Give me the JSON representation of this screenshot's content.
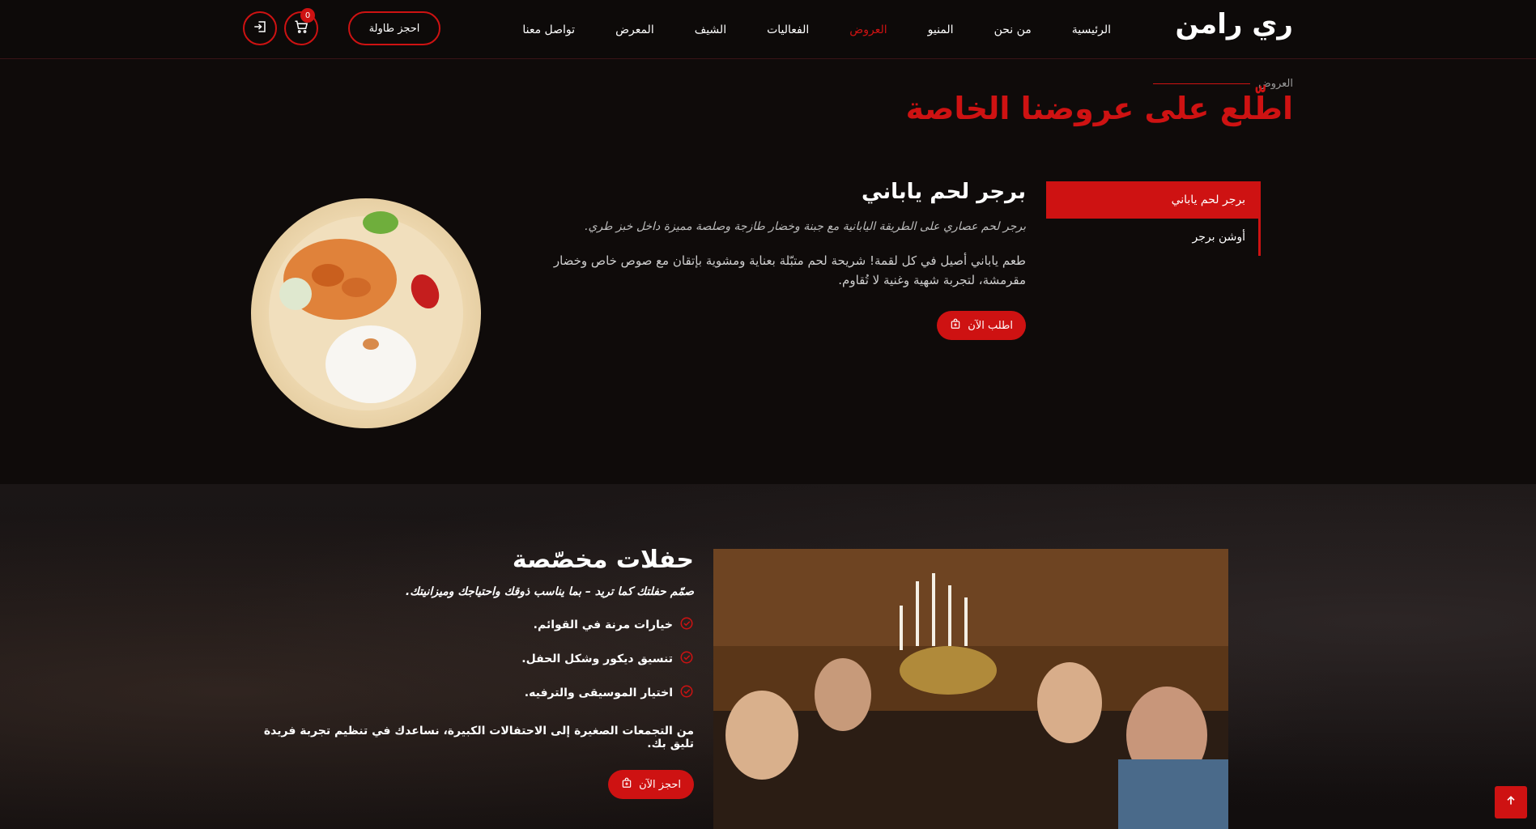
{
  "header": {
    "logo": "ري رامن",
    "nav": [
      {
        "label": "الرئيسية",
        "active": false
      },
      {
        "label": "من نحن",
        "active": false
      },
      {
        "label": "المنيو",
        "active": false
      },
      {
        "label": "العروض",
        "active": true
      },
      {
        "label": "الفعاليات",
        "active": false
      },
      {
        "label": "الشيف",
        "active": false
      },
      {
        "label": "المعرض",
        "active": false
      },
      {
        "label": "تواصل معنا",
        "active": false
      }
    ],
    "book_label": "احجز طاولة",
    "cart_count": "0",
    "cart_icon": "cart-icon",
    "login_icon": "login-icon"
  },
  "offers": {
    "eyebrow": "العروض",
    "title": "اطّلع على عروضنا الخاصة",
    "tabs": [
      {
        "label": "برجر لحم ياباني",
        "active": true
      },
      {
        "label": "أوشن برجر",
        "active": false
      }
    ],
    "active_offer": {
      "title": "برجر لحم ياباني",
      "subtitle": "برجر لحم عصاري على الطريقة اليابانية مع جبنة وخضار طازجة وصلصة مميزة داخل خبز طري.",
      "description": "طعم ياباني أصيل في كل لقمة! شريحة لحم متبّلة بعناية ومشوية بإتقان مع صوص خاص وخضار مقرمشة، لتجربة شهية وغنية لا تُقاوم.",
      "order_label": "اطلب الآن"
    }
  },
  "party": {
    "title": "حفلات مخصّصة",
    "subtitle": "صمّم حفلتك كما تريد – بما يناسب ذوقك واحتياجك وميزانيتك.",
    "list": [
      "خيارات مرنة في القوائم.",
      "تنسيق ديكور وشكل الحفل.",
      "اختيار الموسيقى والترفيه."
    ],
    "paragraph": "من التجمعات الصغيرة إلى الاحتفالات الكبيرة، نساعدك في تنظيم تجربة فريدة تليق بك.",
    "book_label": "احجز الآن"
  },
  "colors": {
    "accent": "#ce1212",
    "background": "#0f0b0a"
  }
}
